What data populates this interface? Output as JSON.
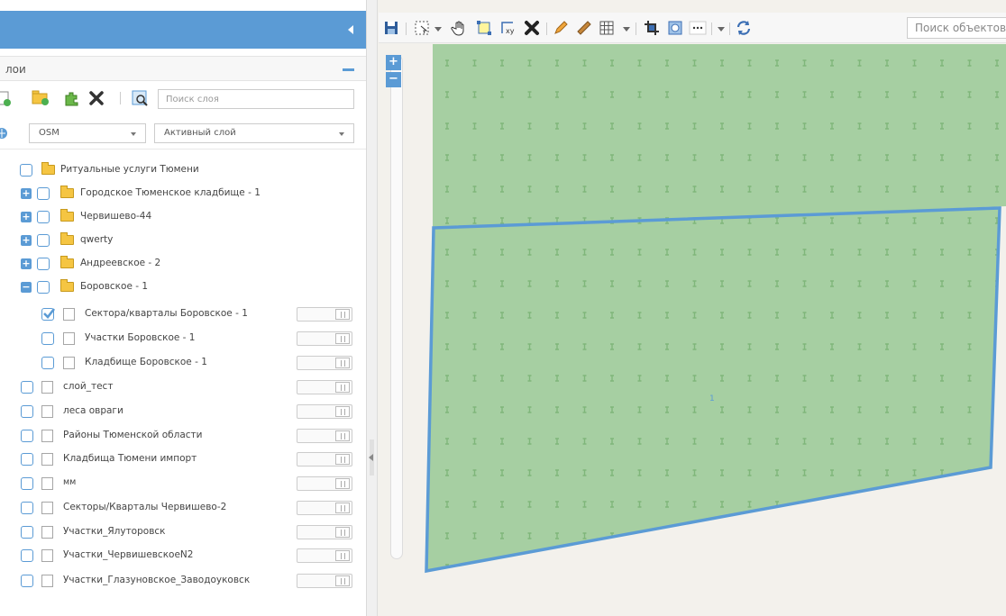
{
  "layers_panel": {
    "title": "лои",
    "search_placeholder": "Поиск слоя",
    "basemap_select": "OSM",
    "active_layer_select": "Активный слой"
  },
  "tree": [
    {
      "label": "Ритуальные услуги Тюмени"
    },
    {
      "label": "Городское Тюменское кладбище - 1"
    },
    {
      "label": "Червишево-44"
    },
    {
      "label": "qwerty"
    },
    {
      "label": "Андреевское - 2"
    },
    {
      "label": "Боровское - 1"
    },
    {
      "label": "Сектора/кварталы Боровское - 1",
      "checked": true
    },
    {
      "label": "Участки Боровское - 1"
    },
    {
      "label": "Кладбище Боровское - 1"
    },
    {
      "label": "слой_тест"
    },
    {
      "label": "леса овраги"
    },
    {
      "label": "Районы Тюменской области"
    },
    {
      "label": "Кладбища Тюмени импорт"
    },
    {
      "label": "мм"
    },
    {
      "label": "Секторы/Кварталы Червишево-2"
    },
    {
      "label": "Участки_Ялуторовск"
    },
    {
      "label": "Участки_ЧервишевскоеN2"
    },
    {
      "label": "Участки_Глазуновское_Заводоуковск"
    }
  ],
  "toolbar": {
    "search_placeholder": "Поиск объектов"
  },
  "map": {
    "zoom_in": "+",
    "zoom_out": "−",
    "polygon_label": "1"
  },
  "colors": {
    "accent": "#5b9bd5",
    "polygon_fill": "#a6cfa2",
    "polygon_stroke": "#5b9bd5",
    "map_bg": "#f3f1ec"
  }
}
